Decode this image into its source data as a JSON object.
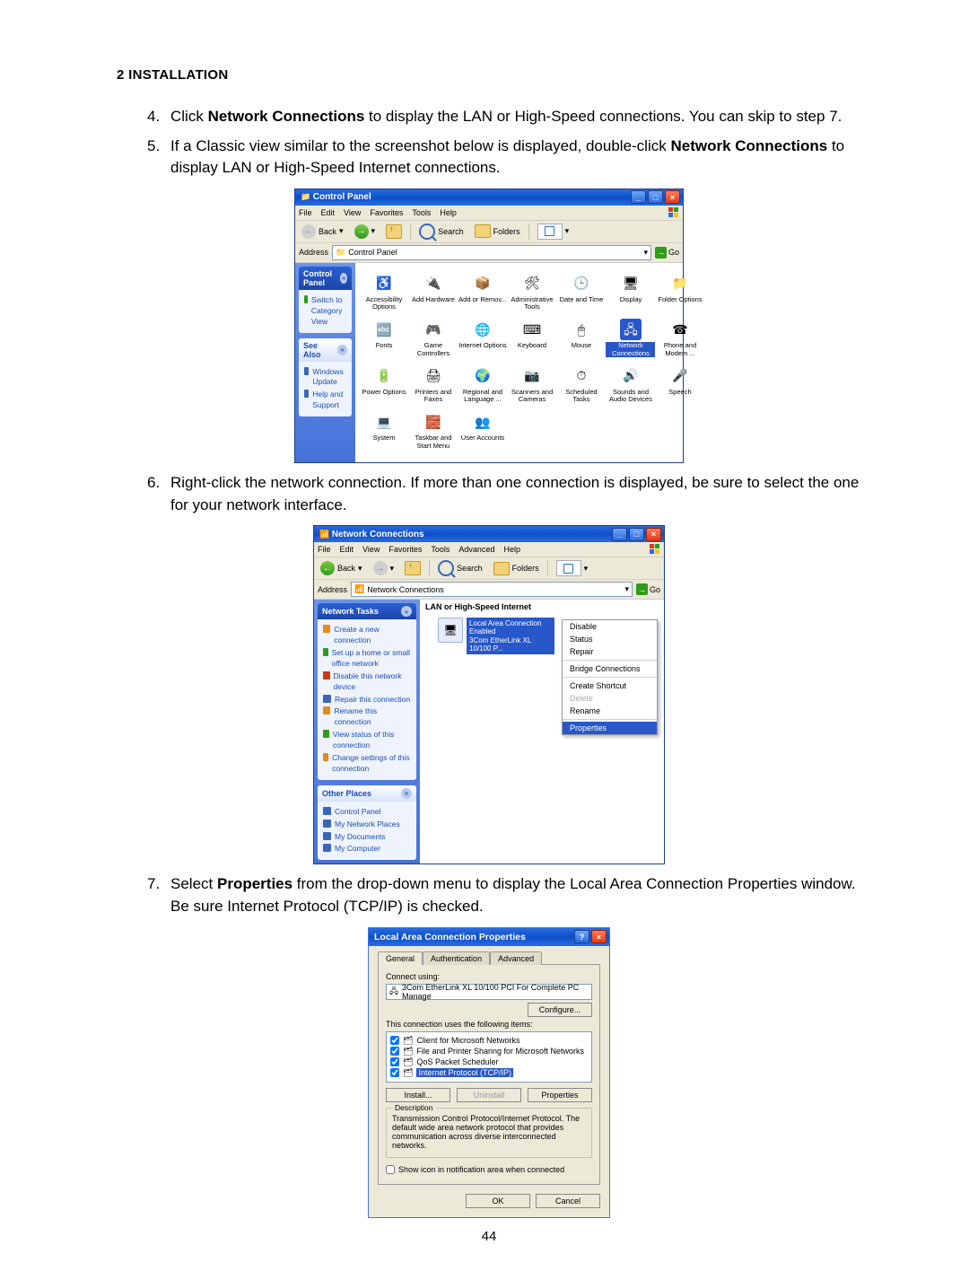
{
  "section_head": "2 INSTALLATION",
  "page_number": "44",
  "step4": {
    "num": "4.",
    "pre": "Click ",
    "bold": "Network Connections",
    "post": " to display the LAN or High-Speed connections. You can skip to step 7."
  },
  "step5": {
    "num": "5.",
    "pre": "If a Classic view similar to the screenshot below is displayed, double-click ",
    "bold": "Network Connections",
    "post": " to display LAN or High-Speed Internet connections."
  },
  "step6": {
    "num": "6.",
    "text": "Right-click the network connection. If more than one connection is displayed, be sure to select the one for your network interface."
  },
  "step7": {
    "num": "7.",
    "pre": "Select ",
    "bold": "Properties",
    "post": " from the drop-down menu to display the Local Area Connection Properties window. Be sure Internet Protocol (TCP/IP) is checked."
  },
  "scr1": {
    "title": "Control Panel",
    "menus": [
      "File",
      "Edit",
      "View",
      "Favorites",
      "Tools",
      "Help"
    ],
    "tb": {
      "back": "Back",
      "search": "Search",
      "folders": "Folders"
    },
    "addr": {
      "label": "Address",
      "value": "Control Panel",
      "go": "Go"
    },
    "left_header": "Control Panel",
    "left_switch": "Switch to Category View",
    "seealso_head": "See Also",
    "seealso": [
      "Windows Update",
      "Help and Support"
    ],
    "icons": [
      "Accessibility Options",
      "Add Hardware",
      "Add or Remov...",
      "Administrative Tools",
      "Date and Time",
      "Display",
      "Folder Options",
      "Fonts",
      "Game Controllers",
      "Internet Options",
      "Keyboard",
      "Mouse",
      "Network Connections",
      "Phone and Modem ...",
      "Power Options",
      "Printers and Faxes",
      "Regional and Language ...",
      "Scanners and Cameras",
      "Scheduled Tasks",
      "Sounds and Audio Devices",
      "Speech",
      "System",
      "Taskbar and Start Menu",
      "User Accounts"
    ]
  },
  "scr2": {
    "title": "Network Connections",
    "menus": [
      "File",
      "Edit",
      "View",
      "Favorites",
      "Tools",
      "Advanced",
      "Help"
    ],
    "tb": {
      "back": "Back",
      "search": "Search",
      "folders": "Folders"
    },
    "addr": {
      "label": "Address",
      "value": "Network Connections",
      "go": "Go"
    },
    "tasks_head": "Network Tasks",
    "tasks": [
      "Create a new connection",
      "Set up a home or small office network",
      "Disable this network device",
      "Repair this connection",
      "Rename this connection",
      "View status of this connection",
      "Change settings of this connection"
    ],
    "other_head": "Other Places",
    "other": [
      "Control Panel",
      "My Network Places",
      "My Documents",
      "My Computer"
    ],
    "cat": "LAN or High-Speed Internet",
    "conn": {
      "name": "Local Area Connection",
      "status": "Enabled",
      "adapter": "3Com EtherLink XL 10/100 P..."
    },
    "ctx": [
      "Disable",
      "Status",
      "Repair",
      "Bridge Connections",
      "Create Shortcut",
      "Delete",
      "Rename",
      "Properties"
    ]
  },
  "scr3": {
    "title": "Local Area Connection Properties",
    "tabs": [
      "General",
      "Authentication",
      "Advanced"
    ],
    "connect_label": "Connect using:",
    "adapter": "3Com EtherLink XL 10/100 PCI For Complete PC Manage",
    "configure": "Configure...",
    "items_label": "This connection uses the following items:",
    "items": [
      "Client for Microsoft Networks",
      "File and Printer Sharing for Microsoft Networks",
      "QoS Packet Scheduler",
      "Internet Protocol (TCP/IP)"
    ],
    "install": "Install...",
    "uninstall": "Uninstall",
    "properties": "Properties",
    "desc_head": "Description",
    "desc_text": "Transmission Control Protocol/Internet Protocol. The default wide area network protocol that provides communication across diverse interconnected networks.",
    "show_icon": "Show icon in notification area when connected",
    "ok": "OK",
    "cancel": "Cancel"
  }
}
